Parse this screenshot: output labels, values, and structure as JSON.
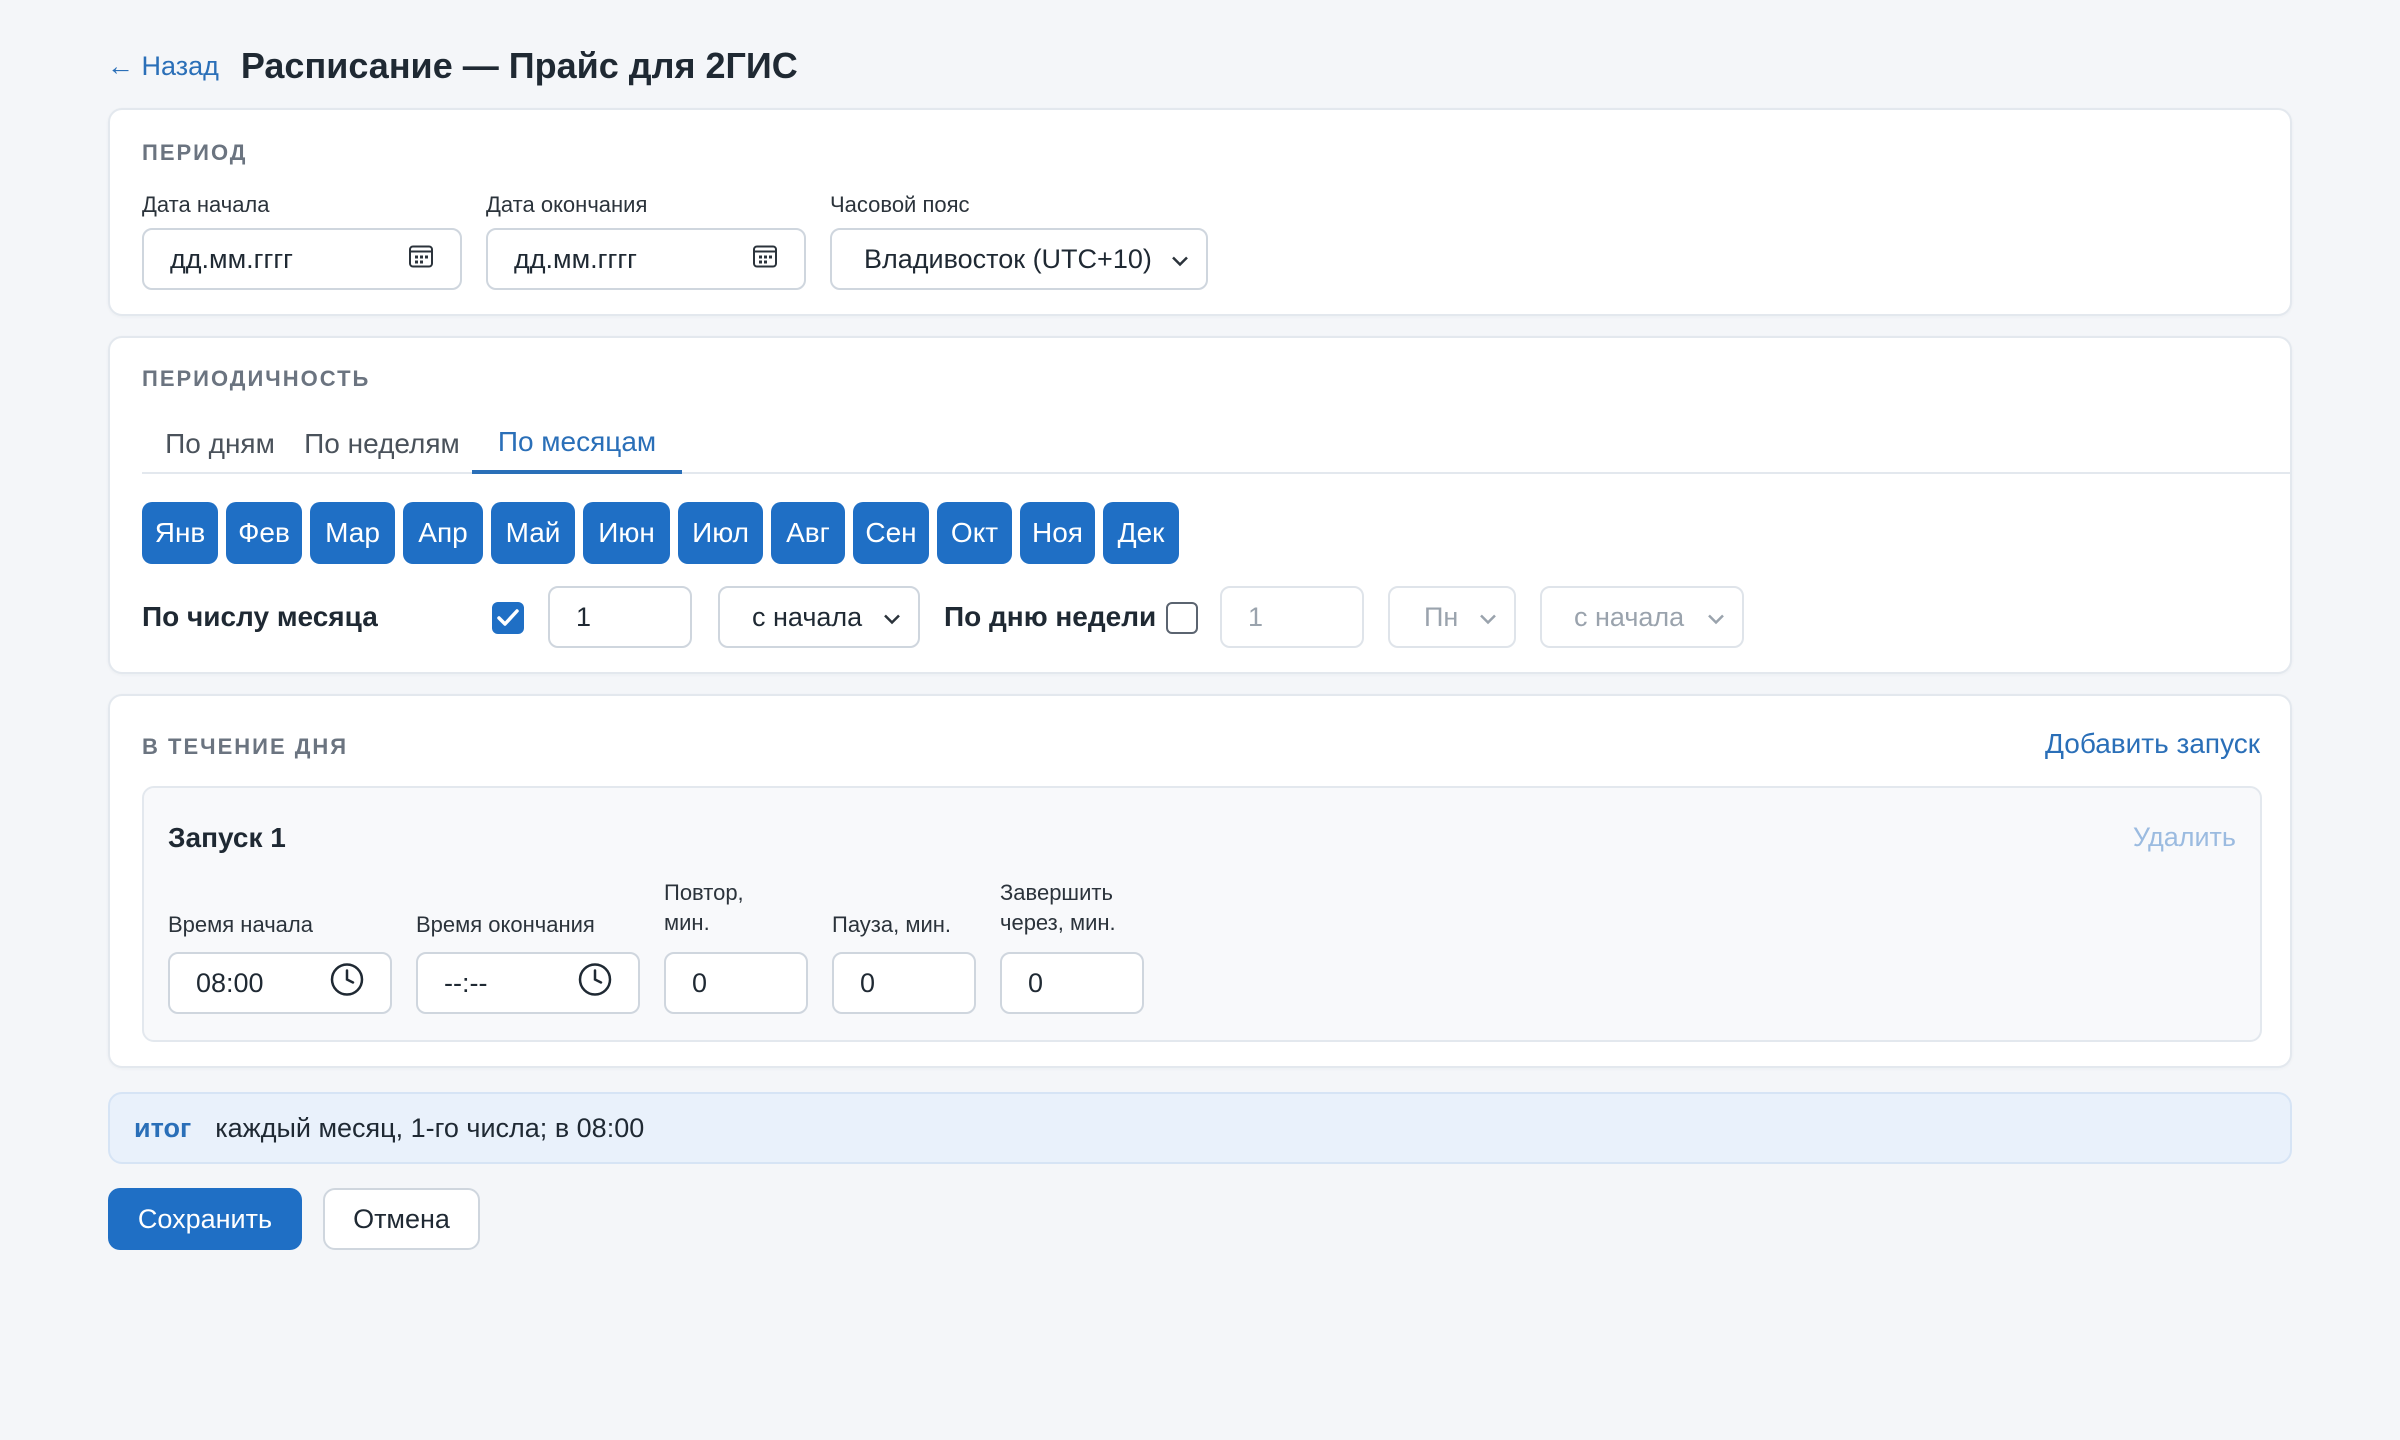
{
  "header": {
    "back_label": "← Назад",
    "title": "Расписание — Прайс для 2ГИС"
  },
  "period": {
    "section_title": "ПЕРИОД",
    "start_label": "Дата начала",
    "start_placeholder": "дд.мм.гггг",
    "end_label": "Дата окончания",
    "end_placeholder": "дд.мм.гггг",
    "tz_label": "Часовой пояс",
    "tz_value": "Владивосток (UTC+10)"
  },
  "periodicity": {
    "section_title": "ПЕРИОДИЧНОСТЬ",
    "tabs": [
      "По дням",
      "По неделям",
      "По месяцам"
    ],
    "active_tab": "По месяцам",
    "months": [
      "Янв",
      "Фев",
      "Мар",
      "Апр",
      "Май",
      "Июн",
      "Июл",
      "Авг",
      "Сен",
      "Окт",
      "Ноя",
      "Дек"
    ],
    "by_day_label": "По числу месяца",
    "by_day_checked": true,
    "by_day_value": "1",
    "by_day_from": "с начала",
    "by_weekday_label": "По дню недели",
    "by_weekday_checked": false,
    "by_weekday_value": "1",
    "by_weekday_day": "Пн",
    "by_weekday_from": "с начала"
  },
  "daytime": {
    "section_title": "В ТЕЧЕНИЕ ДНЯ",
    "add_label": "Добавить запуск",
    "launch": {
      "title": "Запуск 1",
      "delete_label": "Удалить",
      "start_label": "Время начала",
      "start_value": "08:00",
      "end_label": "Время окончания",
      "end_value": "--:--",
      "repeat_label_1": "Повтор,",
      "repeat_label_2": "мин.",
      "repeat_value": "0",
      "pause_label": "Пауза, мин.",
      "pause_value": "0",
      "finish_label_1": "Завершить",
      "finish_label_2": "через, мин.",
      "finish_value": "0"
    }
  },
  "summary": {
    "tag": "итог",
    "text": "каждый месяц, 1-го числа; в 08:00"
  },
  "actions": {
    "save_label": "Сохранить",
    "cancel_label": "Отмена"
  },
  "colors": {
    "accent": "#1f6fc5",
    "link": "#2a6fb8",
    "background": "#f4f6f9"
  }
}
